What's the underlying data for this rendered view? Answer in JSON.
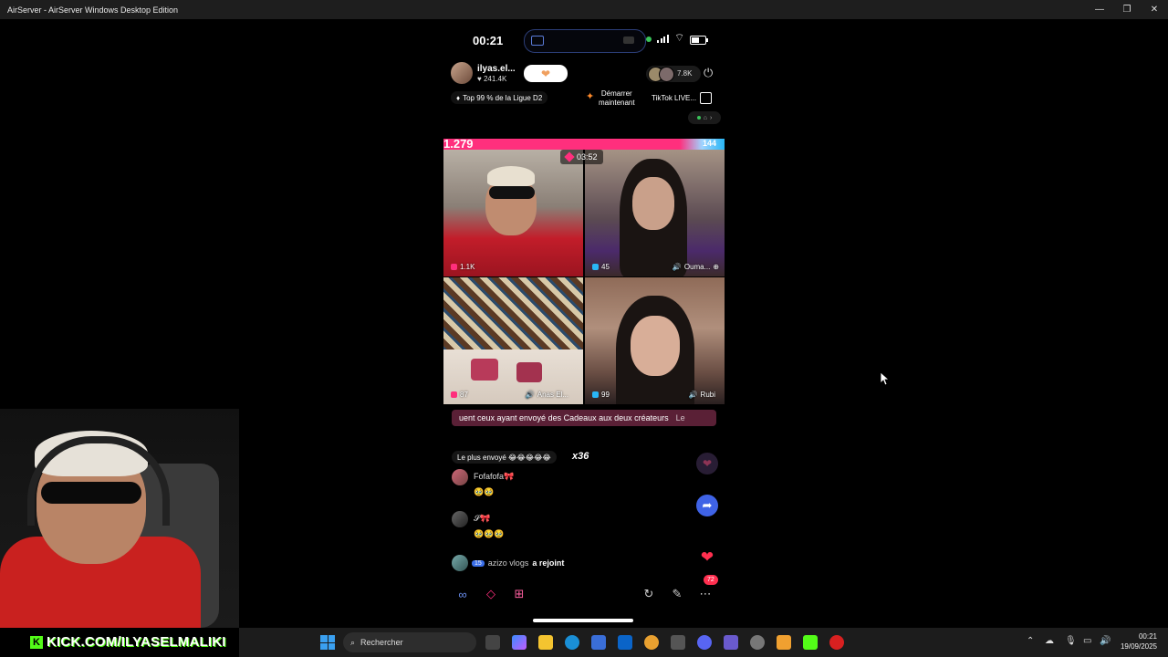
{
  "window": {
    "title": "AirServer - AirServer Windows Desktop Edition"
  },
  "phone": {
    "time": "00:21",
    "host": {
      "name": "ilyas.el...",
      "likes": "241.4K"
    },
    "viewers": "7.8K",
    "rank": "Top 99 % de la Ligue D2",
    "start_line1": "Démarrer",
    "start_line2": "maintenant",
    "tiktok_live": "TikTok LIVE...",
    "battle": {
      "left_score": "1.279",
      "right_score": "144",
      "timer": "03:52"
    },
    "tiles": [
      {
        "score": "1.1K",
        "name": ""
      },
      {
        "score": "45",
        "name": "Ouma..."
      },
      {
        "score": "87",
        "name": "Anas El..."
      },
      {
        "score": "99",
        "name": "Rubi"
      }
    ],
    "ticker": "uent ceux ayant envoyé des Cadeaux aux deux créateurs",
    "ticker_tail": "Le",
    "most_sent": "Le plus envoyé 😂😂😂😂😂",
    "most_sent_mult": "x36",
    "comments": [
      {
        "name": "Fofafofa🎀",
        "message": "🥹🥹"
      },
      {
        "name": "𝓢🎀",
        "message": "🥹🥹🥹"
      }
    ],
    "joined": {
      "level": "15",
      "user": "azizo vlogs",
      "action": "a rejoint"
    },
    "notif_badge": "72"
  },
  "overlay": {
    "kick_text": "KICK.COM/ILYASELMALIKI"
  },
  "taskbar": {
    "search_placeholder": "Rechercher",
    "time": "00:21",
    "date": "19/09/2025"
  },
  "colors": {
    "battle_pink": "#ff2f7d",
    "battle_blue": "#29b6f6",
    "kick_green": "#53fc18"
  }
}
